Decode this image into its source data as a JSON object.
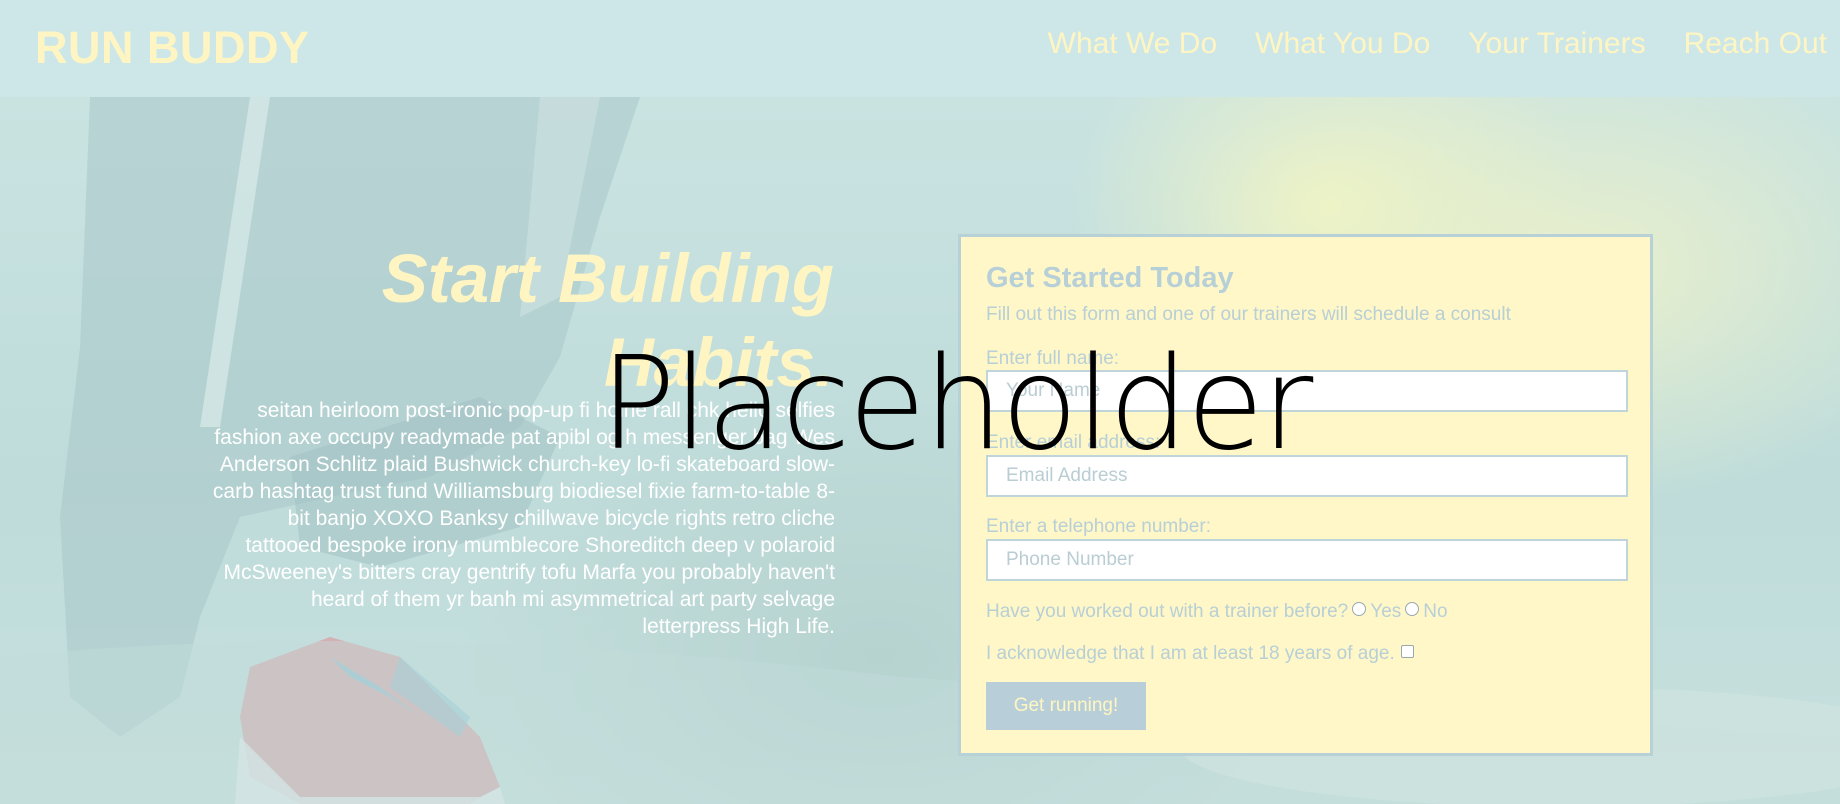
{
  "header": {
    "logo": "RUN BUDDY",
    "nav": [
      "What We Do",
      "What You Do",
      "Your Trainers",
      "Reach Out"
    ]
  },
  "hero": {
    "title": "Start Building Habits.",
    "text": "seitan heirloom post-ironic pop-up fi hoine rall chk hello selfies fashion axe occupy readymade pat apibl og h messenger bag Wes Anderson Schlitz plaid Bushwick church-key lo-fi skateboard slow-carb hashtag trust fund Williamsburg biodiesel fixie farm-to-table 8-bit banjo XOXO Banksy chillwave bicycle rights retro cliche tattooed bespoke irony mumblecore Shoreditch deep v polaroid McSweeney's bitters cray gentrify tofu Marfa you probably haven't heard of them yr banh mi asymmetrical art party selvage letterpress High Life."
  },
  "form": {
    "title": "Get Started Today",
    "subtitle": "Fill out this form and one of our trainers will schedule a consult",
    "name_label": "Enter full name:",
    "name_placeholder": "Your Name",
    "email_label": "Enter email address:",
    "email_placeholder": "Email Address",
    "phone_label": "Enter a telephone number:",
    "phone_placeholder": "Phone Number",
    "trainer_question": "Have you worked out with a trainer before?",
    "yes_label": "Yes",
    "no_label": "No",
    "age_ack": "I acknowledge that I am at least 18 years of age.",
    "submit_label": "Get running!"
  },
  "overlay": {
    "placeholder_text": "Placeholder"
  },
  "colors": {
    "header_bg": "#cde7e9",
    "accent_yellow": "#fff5c2",
    "form_bg": "#fff7c8",
    "muted_blue": "#b7cfd6"
  }
}
